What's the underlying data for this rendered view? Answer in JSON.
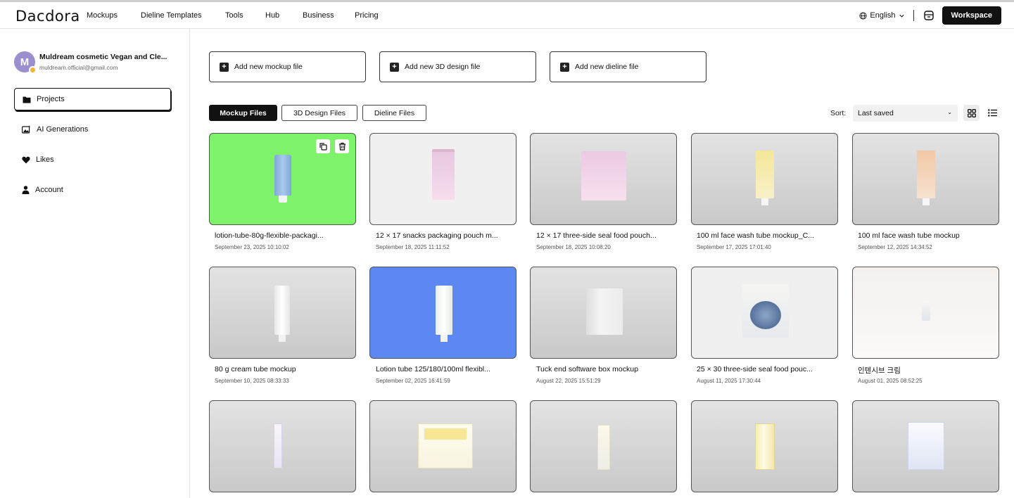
{
  "brand": {
    "logo_text": "Dacdora"
  },
  "nav": {
    "items": [
      "Mockups",
      "Dieline Templates",
      "Tools",
      "Hub",
      "Business",
      "Pricing"
    ]
  },
  "header": {
    "language": "English",
    "workspace_label": "Workspace"
  },
  "user": {
    "initial": "M",
    "name": "Muldream cosmetic Vegan and Cle...",
    "email": "muldream.official@gmail.com"
  },
  "sidebar": {
    "items": [
      {
        "label": "Projects",
        "icon": "folder-icon"
      },
      {
        "label": "AI Generations",
        "icon": "ai-image-icon"
      },
      {
        "label": "Likes",
        "icon": "heart-icon"
      },
      {
        "label": "Account",
        "icon": "person-icon"
      }
    ]
  },
  "actions": {
    "add_mockup": "Add new mockup file",
    "add_3d": "Add new 3D design file",
    "add_dieline": "Add new dieline file"
  },
  "tabs": [
    "Mockup Files",
    "3D Design Files",
    "Dieline Files"
  ],
  "sort": {
    "label": "Sort:",
    "value": "Last saved"
  },
  "colors": {
    "accent": "#111111",
    "green_bg": "#7ef26b",
    "blue_bg": "#5d88f2"
  },
  "cards": [
    {
      "title": "lotion-tube-80g-flexible-packagi...",
      "date": "September 23, 2025 10:10:02"
    },
    {
      "title": "12 × 17 snacks packaging pouch m...",
      "date": "September 18, 2025 11:11:52"
    },
    {
      "title": "12 × 17 three-side seal food pouch...",
      "date": "September 18, 2025 10:08:20"
    },
    {
      "title": "100 ml face wash tube mockup_C...",
      "date": "September 17, 2025 17:01:40"
    },
    {
      "title": "100 ml face wash tube mockup",
      "date": "September 12, 2025 14:34:52"
    },
    {
      "title": "80 g cream tube mockup",
      "date": "September 10, 2025 08:33:33"
    },
    {
      "title": "Lotion tube 125/180/100ml flexibl...",
      "date": "September 02, 2025 16:41:59"
    },
    {
      "title": "Tuck end software box mockup",
      "date": "August 22, 2025 15:51:29"
    },
    {
      "title": "25 × 30 three-side seal food pouc...",
      "date": "August 11, 2025 17:30:44"
    },
    {
      "title": "인텐시브 크림",
      "date": "August 01, 2025 08:52:25"
    }
  ]
}
